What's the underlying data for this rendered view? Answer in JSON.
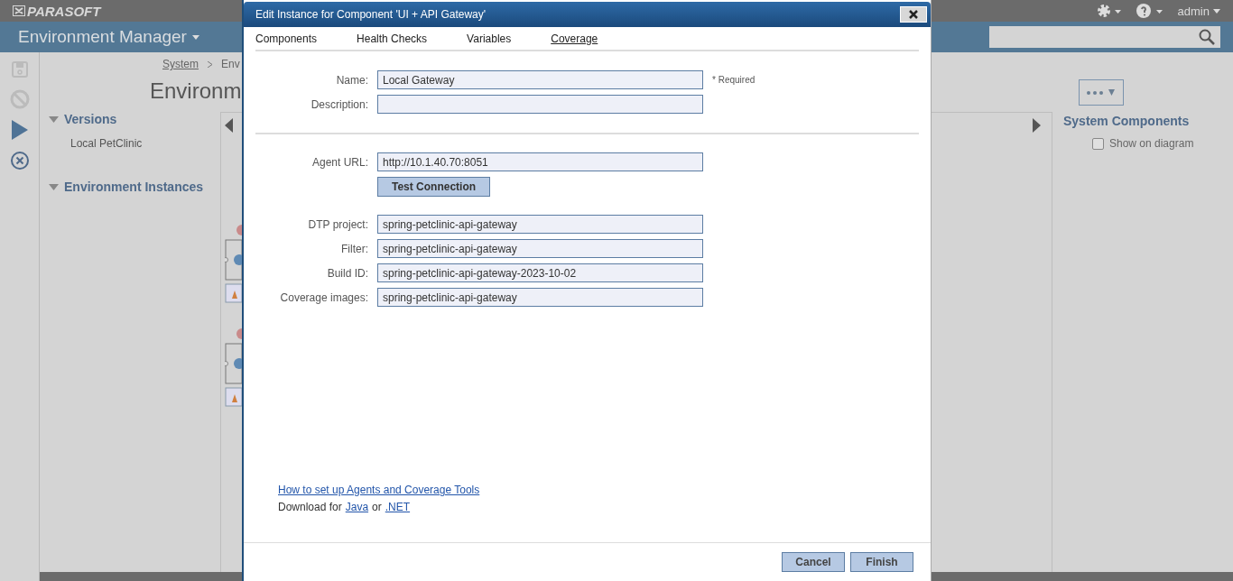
{
  "header": {
    "brand": "PARASOFT",
    "user": "admin",
    "app_title": "Environment Manager"
  },
  "breadcrumb": [
    "System",
    "Env"
  ],
  "page_title": "Environm",
  "sidebar": {
    "sections": [
      {
        "title": "Versions",
        "expanded": true,
        "items": [
          "Local PetClinic"
        ]
      },
      {
        "title": "Environment Instances",
        "expanded": true
      }
    ]
  },
  "right_panel": {
    "title": "System Components",
    "show_on_diagram": {
      "label": "Show on diagram",
      "checked": false
    }
  },
  "dialog": {
    "title": "Edit Instance for Component 'UI + API Gateway'",
    "tabs": [
      {
        "label": "Components",
        "selected": false
      },
      {
        "label": "Health Checks",
        "selected": false
      },
      {
        "label": "Variables",
        "selected": false
      },
      {
        "label": "Coverage",
        "selected": true
      }
    ],
    "identity_fields": [
      {
        "label": "Name:",
        "value": "Local Gateway",
        "required_note": "* Required"
      },
      {
        "label": "Description:"
      }
    ],
    "agent_url": {
      "label": "Agent URL:",
      "value": "http://10.1.40.70:8051"
    },
    "test_button": "Test Connection",
    "coverage_fields": [
      {
        "label": "DTP project:",
        "value": "spring-petclinic-api-gateway"
      },
      {
        "label": "Filter:",
        "value": "spring-petclinic-api-gateway"
      },
      {
        "label": "Build ID:",
        "value": "spring-petclinic-api-gateway-2023-10-02"
      },
      {
        "label": "Coverage images:",
        "value": "spring-petclinic-api-gateway"
      }
    ],
    "help_link": "How to set up Agents and Coverage Tools",
    "download": {
      "prefix": "Download for",
      "java": "Java",
      "or": "or",
      "net": ".NET"
    },
    "buttons": [
      "Cancel",
      "Finish"
    ]
  }
}
